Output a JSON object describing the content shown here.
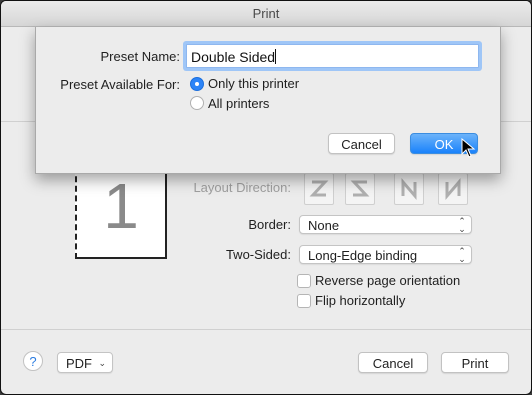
{
  "window": {
    "title": "Print"
  },
  "preview": {
    "page_number": "1"
  },
  "layout": {
    "direction_label": "Layout Direction:",
    "border_label": "Border:",
    "border_value": "None",
    "two_sided_label": "Two-Sided:",
    "two_sided_value": "Long-Edge binding",
    "reverse_label": "Reverse page orientation",
    "flip_label": "Flip horizontally"
  },
  "footer": {
    "help": "?",
    "pdf_label": "PDF",
    "cancel_label": "Cancel",
    "print_label": "Print"
  },
  "sheet": {
    "preset_name_label": "Preset Name:",
    "preset_name_value": "Double Sided",
    "available_for_label": "Preset Available For:",
    "options": [
      {
        "label": "Only this printer",
        "selected": true
      },
      {
        "label": "All printers",
        "selected": false
      }
    ],
    "cancel_label": "Cancel",
    "ok_label": "OK"
  },
  "colors": {
    "accent": "#1a82fb",
    "focus_ring": "#9fc6f7"
  }
}
